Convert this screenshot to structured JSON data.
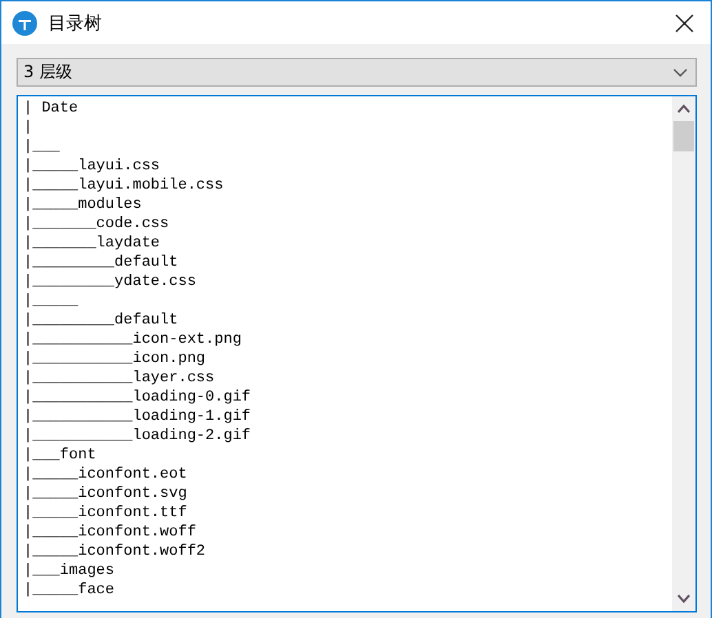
{
  "window": {
    "title": "目录树"
  },
  "level_select": {
    "value": "3 层级"
  },
  "tree_text": {
    "lines": [
      "| Date",
      "|",
      "|___",
      "|_____layui.css",
      "|_____layui.mobile.css",
      "|_____modules",
      "|_______code.css",
      "|_______laydate",
      "|_________default",
      "|_________ydate.css",
      "|_____",
      "|_________default",
      "|___________icon-ext.png",
      "|___________icon.png",
      "|___________layer.css",
      "|___________loading-0.gif",
      "|___________loading-1.gif",
      "|___________loading-2.gif",
      "|___font",
      "|_____iconfont.eot",
      "|_____iconfont.svg",
      "|_____iconfont.ttf",
      "|_____iconfont.woff",
      "|_____iconfont.woff2",
      "|___images",
      "|_____face"
    ]
  }
}
